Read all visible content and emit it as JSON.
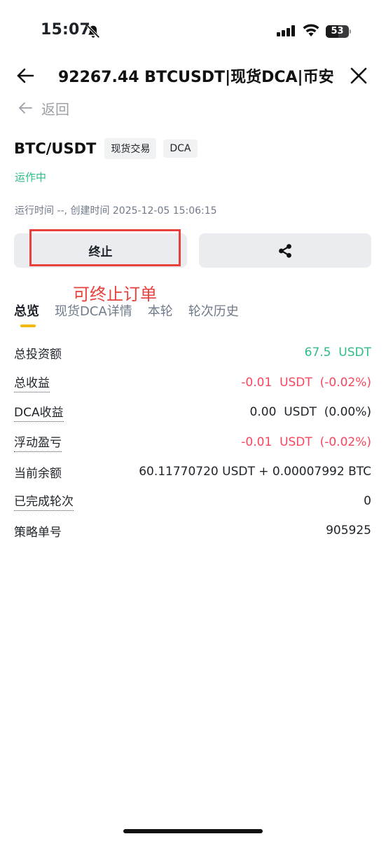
{
  "status_bar": {
    "time": "15:07",
    "battery": "53"
  },
  "header": {
    "title": "92267.44 BTCUSDT|现货DCA|币安",
    "back_label": "返回"
  },
  "pair": {
    "name": "BTC/USDT",
    "tags": [
      "现货交易",
      "DCA"
    ],
    "status": "运作中",
    "meta": "运行时间 --, 创建时间 2025-12-05 15:06:15"
  },
  "actions": {
    "stop_label": "终止",
    "annotation": "可终止订单"
  },
  "tabs": [
    {
      "label": "总览"
    },
    {
      "label": "现货DCA详情"
    },
    {
      "label": "本轮"
    },
    {
      "label": "轮次历史"
    }
  ],
  "rows": [
    {
      "label": "总投资额",
      "value": "67.5  USDT"
    },
    {
      "label": "总收益",
      "value": "-0.01  USDT  (-0.02%)"
    },
    {
      "label": "DCA收益",
      "value": "0.00  USDT  (0.00%)"
    },
    {
      "label": "浮动盈亏",
      "value": "-0.01  USDT  (-0.02%)"
    },
    {
      "label": "当前余额",
      "value": "60.11770720 USDT + 0.00007992 BTC"
    },
    {
      "label": "已完成轮次",
      "value": "0"
    },
    {
      "label": "策略单号",
      "value": "905925"
    }
  ],
  "colors": {
    "positive": "#2ebd85",
    "negative": "#f6465d",
    "accent": "#f0b90b",
    "annotation": "#e8413c"
  },
  "icons": [
    "bell-slash-icon",
    "cellular-signal-icon",
    "wifi-icon",
    "battery-icon",
    "arrow-left-icon",
    "close-icon",
    "share-icon"
  ]
}
